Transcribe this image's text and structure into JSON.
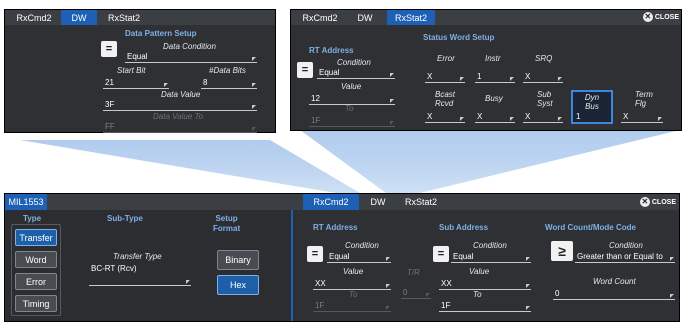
{
  "top_left": {
    "tabs": [
      "RxCmd2",
      "DW",
      "RxStat2"
    ],
    "active_tab": 1,
    "section_title": "Data Pattern Setup",
    "condition": {
      "label": "Data Condition",
      "value": "Equal"
    },
    "start_bit": {
      "label": "Start Bit",
      "value": "21"
    },
    "data_bits": {
      "label": "#Data Bits",
      "value": "8"
    },
    "data_value": {
      "label": "Data Value",
      "value": "3F"
    },
    "data_value_to": {
      "label": "Data Value To",
      "value": "FF"
    }
  },
  "top_right": {
    "tabs": [
      "RxCmd2",
      "DW",
      "RxStat2"
    ],
    "active_tab": 2,
    "close_label": "CLOSE",
    "rt_address": {
      "title": "RT Address",
      "condition_label": "Condition",
      "condition_value": "Equal",
      "value_label": "Value",
      "value": "12",
      "to_label": "To",
      "to_value": "1F"
    },
    "status_word": {
      "title": "Status Word Setup",
      "fields": [
        {
          "label": "Error",
          "value": "X"
        },
        {
          "label": "Instr",
          "value": "1"
        },
        {
          "label": "SRQ",
          "value": "X"
        },
        {
          "label": "Bcast\nRcvd",
          "value": "X"
        },
        {
          "label": "Busy",
          "value": "X"
        },
        {
          "label": "Sub\nSyst",
          "value": "X"
        },
        {
          "label": "Dyn\nBus",
          "value": "1"
        },
        {
          "label": "Term\nFlg",
          "value": "X"
        }
      ]
    }
  },
  "bottom": {
    "title_tab": "MIL1553",
    "tabs": [
      "RxCmd2",
      "DW",
      "RxStat2"
    ],
    "active_tab": 0,
    "close_label": "CLOSE",
    "type": {
      "title": "Type",
      "buttons": [
        "Transfer",
        "Word",
        "Error",
        "Timing"
      ],
      "active": 0
    },
    "subtype": {
      "title": "Sub-Type",
      "label": "Transfer Type",
      "value": "BC-RT (Rcv)"
    },
    "setup_format": {
      "title": "Setup\nFormat",
      "buttons": [
        "Binary",
        "Hex"
      ],
      "active": 1
    },
    "rt_address": {
      "title": "RT Address",
      "condition_label": "Condition",
      "condition_value": "Equal",
      "value_label": "Value",
      "value": "XX",
      "to_label": "To",
      "to_value": "1F"
    },
    "tr": {
      "label": "T/R",
      "value": "0"
    },
    "sub_address": {
      "title": "Sub Address",
      "condition_label": "Condition",
      "condition_value": "Equal",
      "value_label": "Value",
      "value": "XX",
      "to_label": "To",
      "to_value": "1F"
    },
    "word_count": {
      "title": "Word Count/Mode Code",
      "condition_label": "Condition",
      "condition_value": "Greater than  or Equal to",
      "count_label": "Word Count",
      "count_value": "0"
    }
  },
  "colors": {
    "panel_bg": "#2e3033",
    "tab_active": "#1e60b4",
    "accent_text": "#7fb0e8",
    "beam": "#a9c8ee"
  }
}
